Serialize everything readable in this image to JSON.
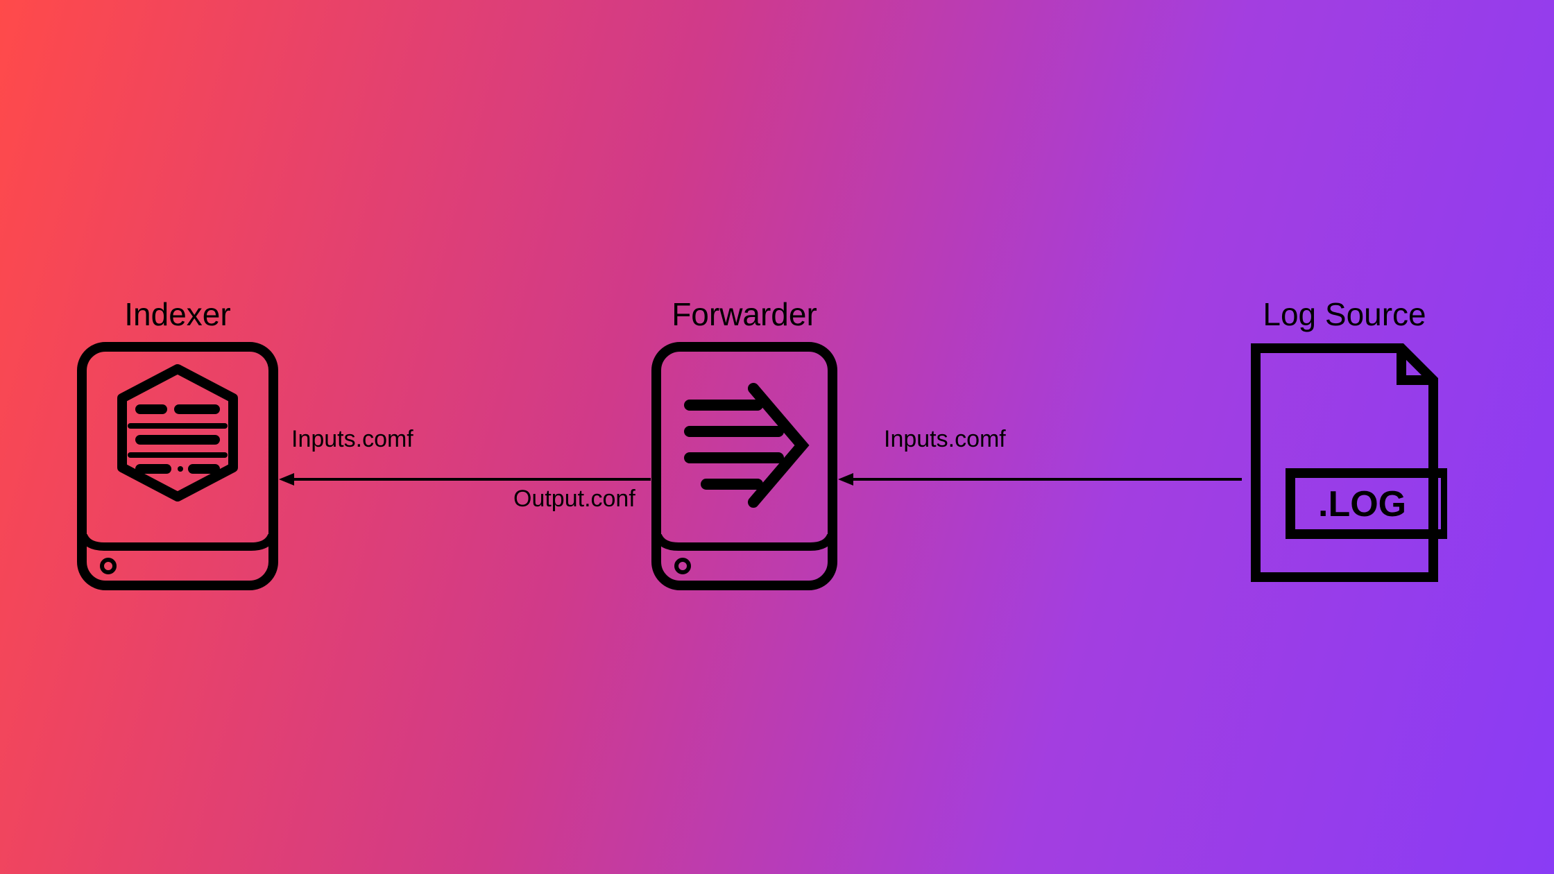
{
  "nodes": {
    "indexer": {
      "title": "Indexer"
    },
    "forwarder": {
      "title": "Forwarder"
    },
    "logsource": {
      "title": "Log Source",
      "file_ext": ".LOG"
    }
  },
  "arrows": {
    "left": {
      "top_label": "Inputs.comf",
      "bottom_label": "Output.conf"
    },
    "right": {
      "top_label": "Inputs.comf"
    }
  }
}
